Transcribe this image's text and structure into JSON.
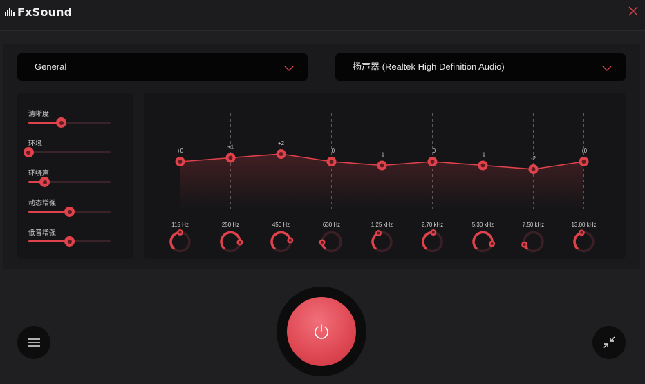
{
  "app": {
    "title": "FxSound"
  },
  "colors": {
    "accent": "#e0424c",
    "accent_dark": "#5a1d22",
    "close": "#e0424c"
  },
  "preset_dropdown": {
    "selected": "General"
  },
  "device_dropdown": {
    "selected": "扬声器 (Realtek High Definition Audio)"
  },
  "effects": [
    {
      "label": "清晰度",
      "value": 0.4
    },
    {
      "label": "环境",
      "value": 0.0
    },
    {
      "label": "环绕声",
      "value": 0.2
    },
    {
      "label": "动态增强",
      "value": 0.5
    },
    {
      "label": "低音增强",
      "value": 0.5
    }
  ],
  "eq": {
    "gain_range": [
      -12,
      12
    ],
    "bands": [
      {
        "freq": "115 Hz",
        "gain": 0,
        "gain_label": "+0",
        "knob": 0.5
      },
      {
        "freq": "250 Hz",
        "gain": 1,
        "gain_label": "+1",
        "knob": 0.85
      },
      {
        "freq": "450 Hz",
        "gain": 2,
        "gain_label": "+2",
        "knob": 0.8
      },
      {
        "freq": "630 Hz",
        "gain": 0,
        "gain_label": "+0",
        "knob": 0.15
      },
      {
        "freq": "1.25 kHz",
        "gain": -1,
        "gain_label": "-1",
        "knob": 0.42
      },
      {
        "freq": "2.70 kHz",
        "gain": 0,
        "gain_label": "+0",
        "knob": 0.52
      },
      {
        "freq": "5.30 kHz",
        "gain": -1,
        "gain_label": "-1",
        "knob": 0.88
      },
      {
        "freq": "7.50 kHz",
        "gain": -2,
        "gain_label": "-2",
        "knob": 0.1
      },
      {
        "freq": "13.00 kHz",
        "gain": 0,
        "gain_label": "+0",
        "knob": 0.45
      }
    ]
  },
  "icons": {
    "logo": "bars-logo-icon",
    "close": "close-icon",
    "chevron": "chevron-down-icon",
    "power": "power-icon",
    "menu": "hamburger-menu-icon",
    "shrink": "minimize-arrows-icon"
  }
}
